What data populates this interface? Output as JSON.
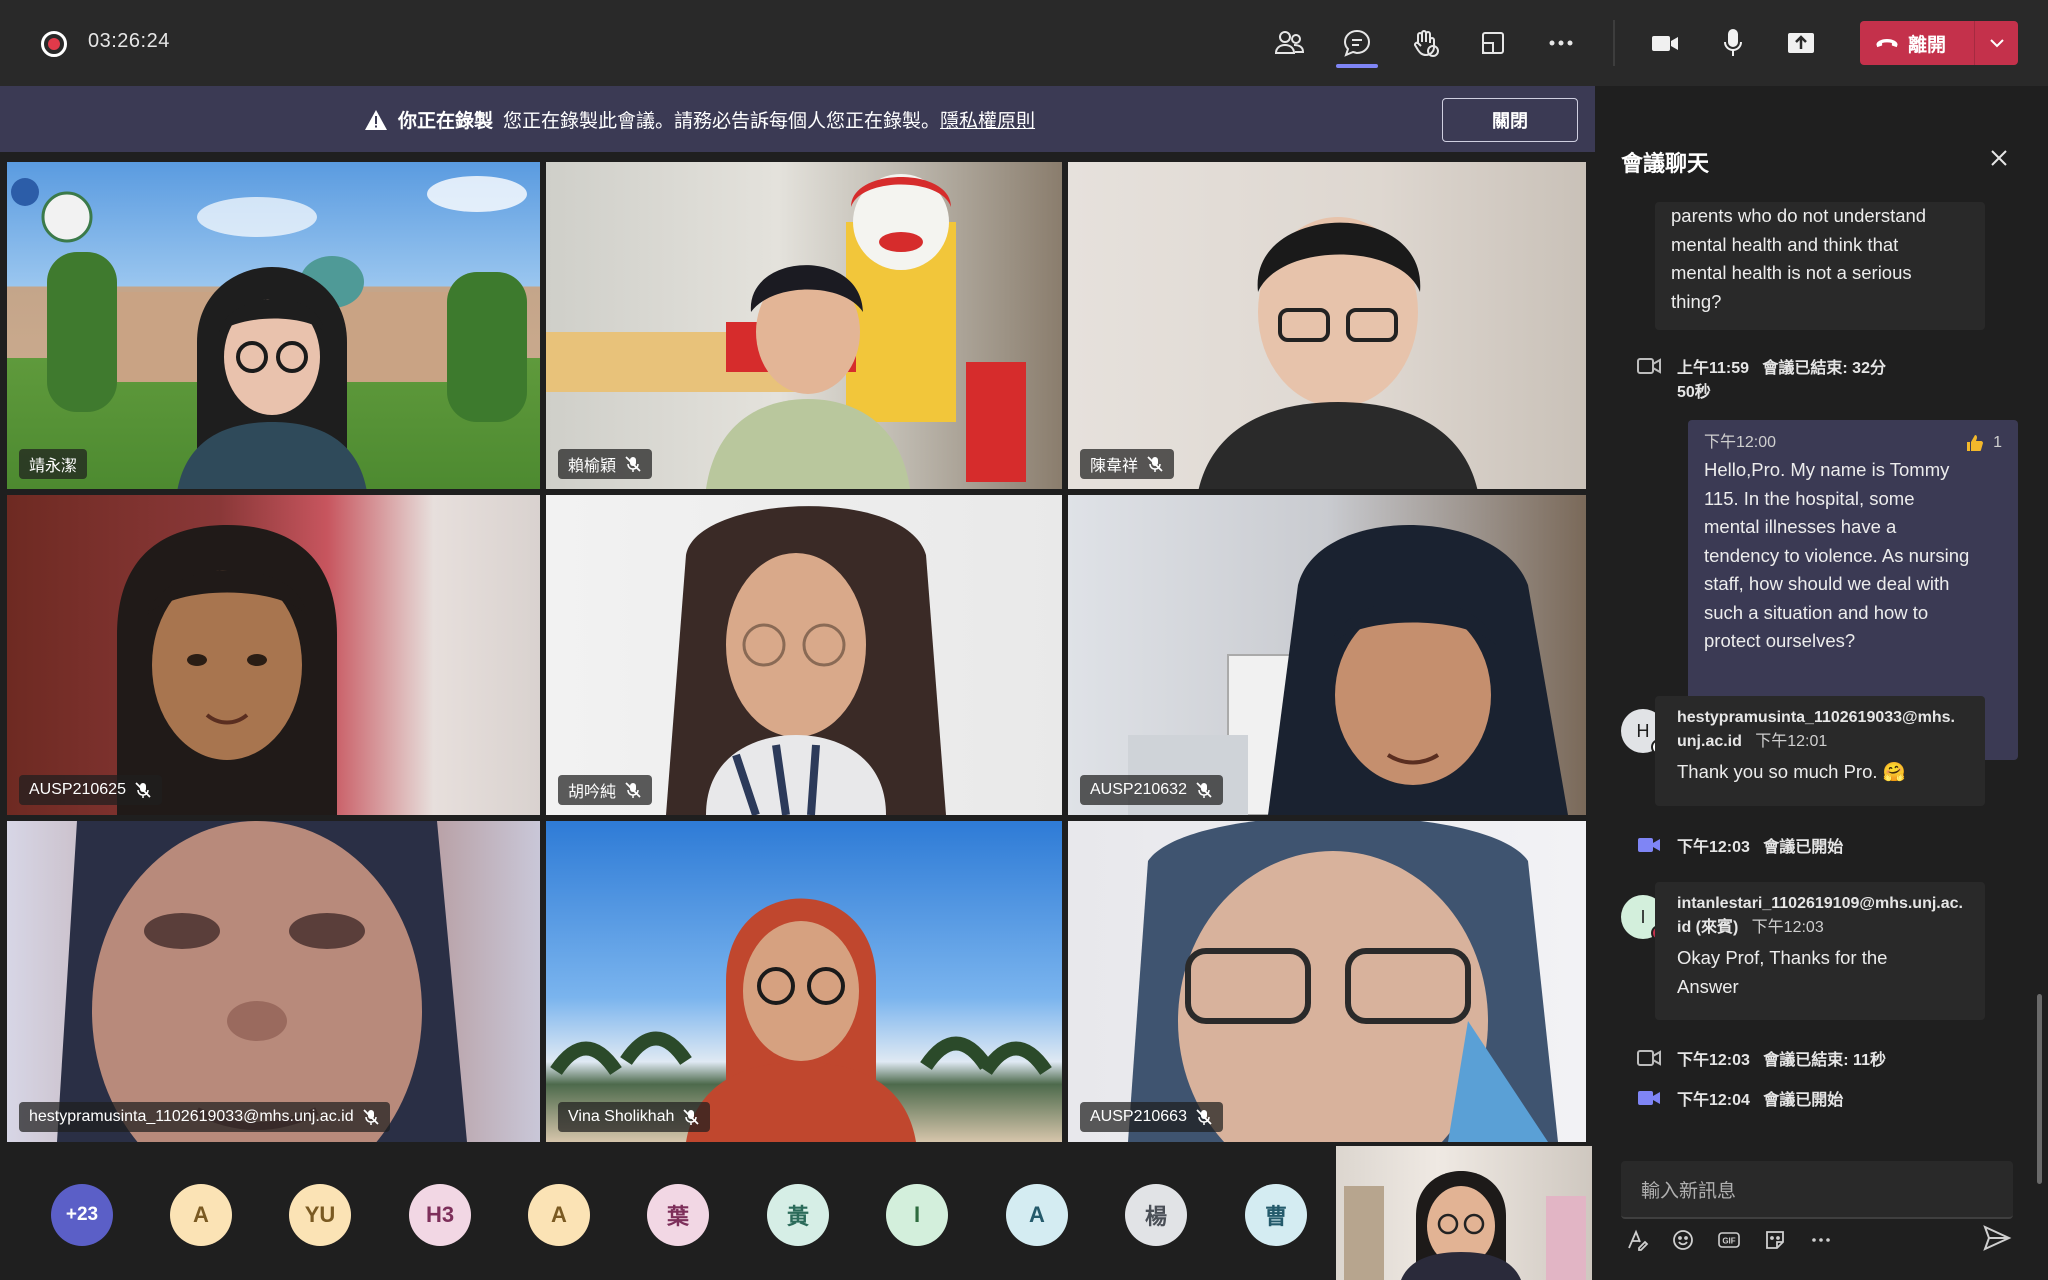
{
  "topbar": {
    "timer": "03:26:24",
    "leave_label": "離開",
    "icons": [
      "people-icon",
      "chat-icon",
      "raise-hand-icon",
      "share-tray-icon",
      "more-icon",
      "camera-icon",
      "mic-icon",
      "share-screen-icon"
    ]
  },
  "banner": {
    "title": "你正在錄製",
    "message": "您正在錄製此會議。請務必告訴每個人您正在錄製。",
    "link": "隱私權原則",
    "button": "關閉"
  },
  "tiles": [
    {
      "name": "靖永潔",
      "muted": false
    },
    {
      "name": "賴榆穎",
      "muted": true
    },
    {
      "name": "陳韋祥",
      "muted": true
    },
    {
      "name": "AUSP210625",
      "muted": true
    },
    {
      "name": "胡吟純",
      "muted": true
    },
    {
      "name": "AUSP210632",
      "muted": true
    },
    {
      "name": "hestypramusinta_1102619033@mhs.unj.ac.id",
      "muted": true
    },
    {
      "name": "Vina Sholikhah",
      "muted": true
    },
    {
      "name": "AUSP210663",
      "muted": true
    }
  ],
  "strip": {
    "overflow": "+23",
    "avatars": [
      "A",
      "YU",
      "H3",
      "A",
      "葉",
      "黃",
      "I",
      "A",
      "楊",
      "曹"
    ]
  },
  "chat": {
    "title": "會議聊天",
    "first_bubble_lines": [
      "parents who do not understand",
      "mental health and think that",
      "mental health is not a serious",
      "thing?"
    ],
    "sys1": {
      "time": "上午11:59",
      "text": "會議已結束: 32分",
      "text2": "50秒"
    },
    "my_message": {
      "time": "下午12:00",
      "reaction_count": "1",
      "lines": [
        "Hello,Pro. My name is Tommy",
        "115. In the hospital, some",
        "mental illnesses have a",
        "tendency to violence. As nursing",
        "staff, how should we deal with",
        "such a situation and how to",
        "protect ourselves?"
      ]
    },
    "msg_h": {
      "initial": "H",
      "sender_line1": "hestypramusinta_1102619033@mhs.",
      "sender_line2": "unj.ac.id",
      "time": "下午12:01",
      "text": "Thank you so much Pro. 🤗"
    },
    "sys2": {
      "time": "下午12:03",
      "text": "會議已開始"
    },
    "msg_i": {
      "initial": "I",
      "sender_line1": "intanlestari_1102619109@mhs.unj.ac.",
      "sender_line2": "id (來賓)",
      "time": "下午12:03",
      "lines": [
        "Okay Prof, Thanks for the",
        "Answer"
      ]
    },
    "sys3": {
      "time": "下午12:03",
      "text": "會議已結束: 11秒"
    },
    "sys4": {
      "time": "下午12:04",
      "text": "會議已開始"
    },
    "compose_placeholder": "輸入新訊息",
    "colors": {
      "accent": "#7f85f5",
      "leave": "#c4314b",
      "my_bubble": "#3b3a54"
    }
  }
}
